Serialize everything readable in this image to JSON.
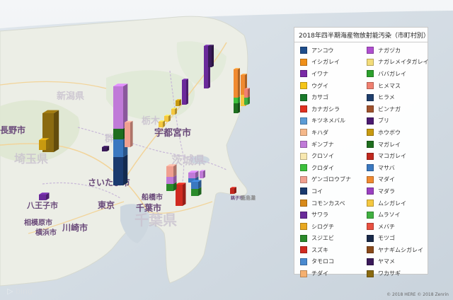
{
  "legend": {
    "title": "2018年四半期海産物放射能汚染（市町村別）",
    "items": [
      {
        "label": "アンコウ",
        "color": "#1f4e8c"
      },
      {
        "label": "ナガヅカ",
        "color": "#b04fd0"
      },
      {
        "label": "イシガレイ",
        "color": "#f0901a"
      },
      {
        "label": "ナガレメイタガレイ",
        "color": "#f3dc7a"
      },
      {
        "label": "イワナ",
        "color": "#7a2aa6"
      },
      {
        "label": "ババガレイ",
        "color": "#2ca02c"
      },
      {
        "label": "ウグイ",
        "color": "#f5c518"
      },
      {
        "label": "ヒメマス",
        "color": "#f08070"
      },
      {
        "label": "カサゴ",
        "color": "#1a7a2a"
      },
      {
        "label": "ヒラメ",
        "color": "#1f3e6c"
      },
      {
        "label": "カナガシラ",
        "color": "#e03020"
      },
      {
        "label": "ビンナガ",
        "color": "#a0522d"
      },
      {
        "label": "キツネメバル",
        "color": "#5b9bd5"
      },
      {
        "label": "ブリ",
        "color": "#4b1a70"
      },
      {
        "label": "キハダ",
        "color": "#f5b88a"
      },
      {
        "label": "ホウボウ",
        "color": "#c89a10"
      },
      {
        "label": "ギンブナ",
        "color": "#c07ad8"
      },
      {
        "label": "マガレイ",
        "color": "#1e6e1e"
      },
      {
        "label": "クロソイ",
        "color": "#f8e8b0"
      },
      {
        "label": "マコガレイ",
        "color": "#c0281e"
      },
      {
        "label": "クロダイ",
        "color": "#3cc03c"
      },
      {
        "label": "マサバ",
        "color": "#3a78c0"
      },
      {
        "label": "ゲンゴロウブナ",
        "color": "#f0a090"
      },
      {
        "label": "マダイ",
        "color": "#f08a30"
      },
      {
        "label": "コイ",
        "color": "#1a3a6e"
      },
      {
        "label": "マダラ",
        "color": "#9a40c0"
      },
      {
        "label": "コモンカスベ",
        "color": "#d88a1a"
      },
      {
        "label": "ムシガレイ",
        "color": "#f5c840"
      },
      {
        "label": "サワラ",
        "color": "#6a2a9a"
      },
      {
        "label": "ムラソイ",
        "color": "#40b040"
      },
      {
        "label": "シログチ",
        "color": "#e8a820"
      },
      {
        "label": "メバチ",
        "color": "#e85040"
      },
      {
        "label": "スジエビ",
        "color": "#2a8a2a"
      },
      {
        "label": "モツゴ",
        "color": "#1a2a4a"
      },
      {
        "label": "スズキ",
        "color": "#d02a20"
      },
      {
        "label": "ヤナギムシガレイ",
        "color": "#8a4a1a"
      },
      {
        "label": "タモロコ",
        "color": "#4a8ad0"
      },
      {
        "label": "ヤマメ",
        "color": "#3a1a5a"
      },
      {
        "label": "チダイ",
        "color": "#f5b070"
      },
      {
        "label": "ワカサギ",
        "color": "#8a6a10"
      }
    ]
  },
  "map_labels": {
    "utsunomiya": "宇都宮市",
    "nagano": "長野市",
    "saitama_pref": "埼玉県",
    "saitama_city": "さいたま市",
    "hachioji": "八王子市",
    "tokyo": "東京",
    "funabashi": "船橋市",
    "chiba_city": "千葉市",
    "kawasaki": "川崎市",
    "sagamihara": "相模原市",
    "yokohama": "横浜市",
    "ibaraki": "茨城県",
    "chiba_pref": "千葉県",
    "niigata": "新潟県",
    "tochigi": "栃木",
    "gunma": "群",
    "choshi": "銚子市",
    "kashima": "鹿島灘"
  },
  "attribution": {
    "bing": "bing",
    "copyright": "© 2018 HERE   © 2018 Zenrin"
  }
}
